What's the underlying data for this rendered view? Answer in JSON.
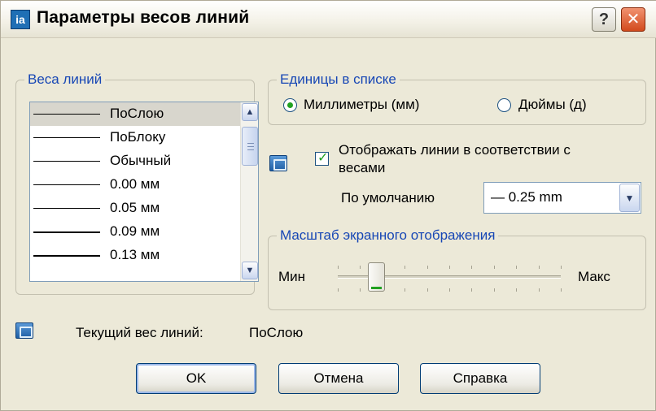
{
  "window": {
    "title": "Параметры весов линий",
    "app_icon_glyph": "ia",
    "help_glyph": "?",
    "close_glyph": "✕"
  },
  "lineweights": {
    "label": "Веса линий",
    "items": [
      {
        "label": "ПоСлою",
        "selected": true
      },
      {
        "label": "ПоБлоку",
        "selected": false
      },
      {
        "label": "Обычный",
        "selected": false
      },
      {
        "label": "0.00 мм",
        "selected": false
      },
      {
        "label": "0.05 мм",
        "selected": false
      },
      {
        "label": "0.09 мм",
        "selected": false
      },
      {
        "label": "0.13 мм",
        "selected": false
      }
    ]
  },
  "units": {
    "label": "Единицы в списке",
    "mm_label": "Миллиметры (мм)",
    "in_label": "Дюймы (д)",
    "selected": "mm"
  },
  "display": {
    "checkbox_label_line1": "Отображать линии в соответствии с",
    "checkbox_label_line2": "весами",
    "checked": true
  },
  "default": {
    "label": "По умолчанию",
    "value": "— 0.25 mm"
  },
  "scale": {
    "label": "Масштаб экранного отображения",
    "min_label": "Мин",
    "max_label": "Макс",
    "value_fraction": 0.17
  },
  "current": {
    "label": "Текущий вес линий:",
    "value": "ПоСлою"
  },
  "buttons": {
    "ok": "OK",
    "cancel": "Отмена",
    "help": "Справка"
  },
  "colors": {
    "group_label": "#1747b5",
    "accent_green": "#21a121",
    "dialog_bg": "#ece9d8"
  }
}
